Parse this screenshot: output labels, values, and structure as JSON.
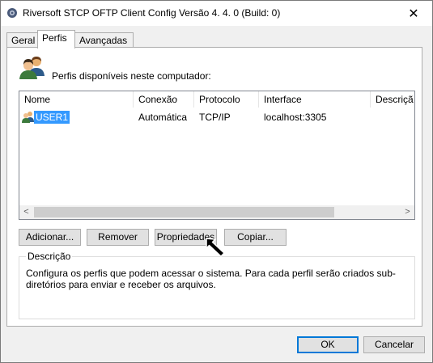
{
  "window": {
    "title": "Riversoft  STCP OFTP Client Config Versão 4. 4. 0 (Build: 0)",
    "close_glyph": "✕"
  },
  "tabs": [
    {
      "label": "Geral",
      "active": false
    },
    {
      "label": "Perfis",
      "active": true
    },
    {
      "label": "Avançadas",
      "active": false
    }
  ],
  "profiles": {
    "icon": "users-icon",
    "label": "Perfis disponíveis neste computador:",
    "columns": [
      "Nome",
      "Conexão",
      "Protocolo",
      "Interface",
      "Descriçã"
    ],
    "rows": [
      {
        "name": "USER1",
        "connection": "Automática",
        "protocol": "TCP/IP",
        "interface": "localhost:3305",
        "description": "",
        "selected": true
      }
    ],
    "scroll_left": "<",
    "scroll_right": ">"
  },
  "buttons": {
    "add": "Adicionar...",
    "remove": "Remover",
    "properties": "Propriedades",
    "copy": "Copiar..."
  },
  "description": {
    "title": "Descrição",
    "text": "Configura os perfis que podem acessar o sistema. Para cada perfil serão criados sub-diretórios para enviar e receber os arquivos."
  },
  "footer": {
    "ok": "OK",
    "cancel": "Cancelar"
  },
  "colors": {
    "selection": "#3399ff",
    "default_button_border": "#0078d7"
  }
}
